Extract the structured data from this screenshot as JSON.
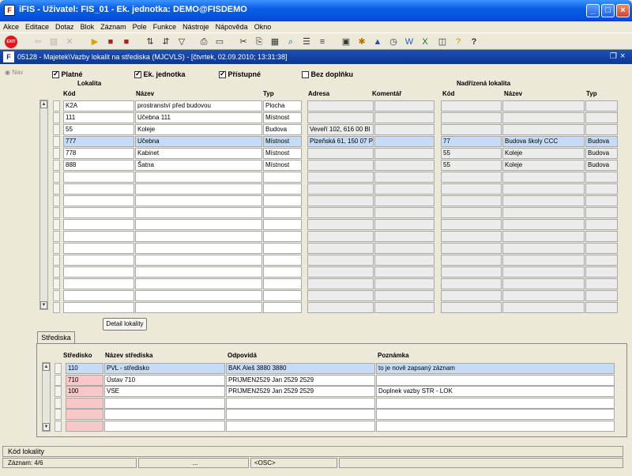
{
  "window": {
    "title": "iFIS - Uživatel: FIS_01 - Ek. jednotka: DEMO@FISDEMO",
    "app_icon": "F"
  },
  "menu": [
    "Akce",
    "Editace",
    "Dotaz",
    "Blok",
    "Záznam",
    "Pole",
    "Funkce",
    "Nástroje",
    "Nápověda",
    "Okno"
  ],
  "toolbar": {
    "exit_label": "EXIT"
  },
  "form": {
    "title": "05128 - Majetek\\Vazby lokalit na střediska (MJCVLS) - [čtvrtek, 02.09.2010; 13:31:38]",
    "icon": "F"
  },
  "nav": {
    "label": "Nav"
  },
  "filters": [
    {
      "label": "Platné",
      "checked": true
    },
    {
      "label": "Ek. jednotka",
      "checked": true
    },
    {
      "label": "Přístupné",
      "checked": true
    },
    {
      "label": "Bez doplňku",
      "checked": false
    }
  ],
  "lokality": {
    "group_label": "Lokalita",
    "parent_group_label": "Nadřízená lokalita",
    "headers": {
      "kod": "Kód",
      "nazev": "Název",
      "typ": "Typ",
      "adresa": "Adresa",
      "komentar": "Komentář",
      "n_kod": "Kód",
      "n_nazev": "Název",
      "n_typ": "Typ"
    },
    "rows": [
      {
        "kod": "K2A",
        "nazev": "prostranství před budovou",
        "typ": "Plocha",
        "adresa": "",
        "komentar": "",
        "n_kod": "",
        "n_nazev": "",
        "n_typ": ""
      },
      {
        "kod": "111",
        "nazev": "Učebna 111",
        "typ": "Místnost",
        "adresa": "",
        "komentar": "",
        "n_kod": "",
        "n_nazev": "",
        "n_typ": ""
      },
      {
        "kod": "55",
        "nazev": "Koleje",
        "typ": "Budova",
        "adresa": "Veveří 102, 616 00 Bl",
        "komentar": "",
        "n_kod": "",
        "n_nazev": "",
        "n_typ": ""
      },
      {
        "kod": "777",
        "nazev": "Učebna",
        "typ": "Místnost",
        "adresa": "Plzeňská 61, 150 07 P",
        "komentar": "",
        "n_kod": "77",
        "n_nazev": "Budova školy CCC",
        "n_typ": "Budova"
      },
      {
        "kod": "778",
        "nazev": "Kabinet",
        "typ": "Místnost",
        "adresa": "",
        "komentar": "",
        "n_kod": "55",
        "n_nazev": "Koleje",
        "n_typ": "Budova"
      },
      {
        "kod": "888",
        "nazev": "Šatna",
        "typ": "Místnost",
        "adresa": "",
        "komentar": "",
        "n_kod": "55",
        "n_nazev": "Koleje",
        "n_typ": "Budova"
      }
    ],
    "selected_row": 3,
    "visible_row_count": 18
  },
  "detail_button": {
    "label": "Detail lokality"
  },
  "tab": {
    "label": "Střediska"
  },
  "strediska": {
    "headers": {
      "stredisko": "Středisko",
      "nazev": "Název střediska",
      "odpovida": "Odpovídá",
      "poznamka": "Poznámka"
    },
    "rows": [
      {
        "stredisko": "110",
        "nazev": "PVL - středisko",
        "odpovida": "BAK Aleš 3880 3880",
        "poznamka": "to je nově zapsaný záznam"
      },
      {
        "stredisko": "710",
        "nazev": "Ústav 710",
        "odpovida": "PRIJMEN2529 Jan 2529 2529",
        "poznamka": ""
      },
      {
        "stredisko": "100",
        "nazev": "VSE",
        "odpovida": "PRIJMEN2529 Jan 2529 2529",
        "poznamka": "Doplnek vazby STR - LOK"
      }
    ],
    "selected_row": 0,
    "visible_row_count": 6
  },
  "status": {
    "message": "Kód lokality",
    "record": "Záznam: 4/6",
    "field2": "...",
    "field3": "<OSC>"
  }
}
